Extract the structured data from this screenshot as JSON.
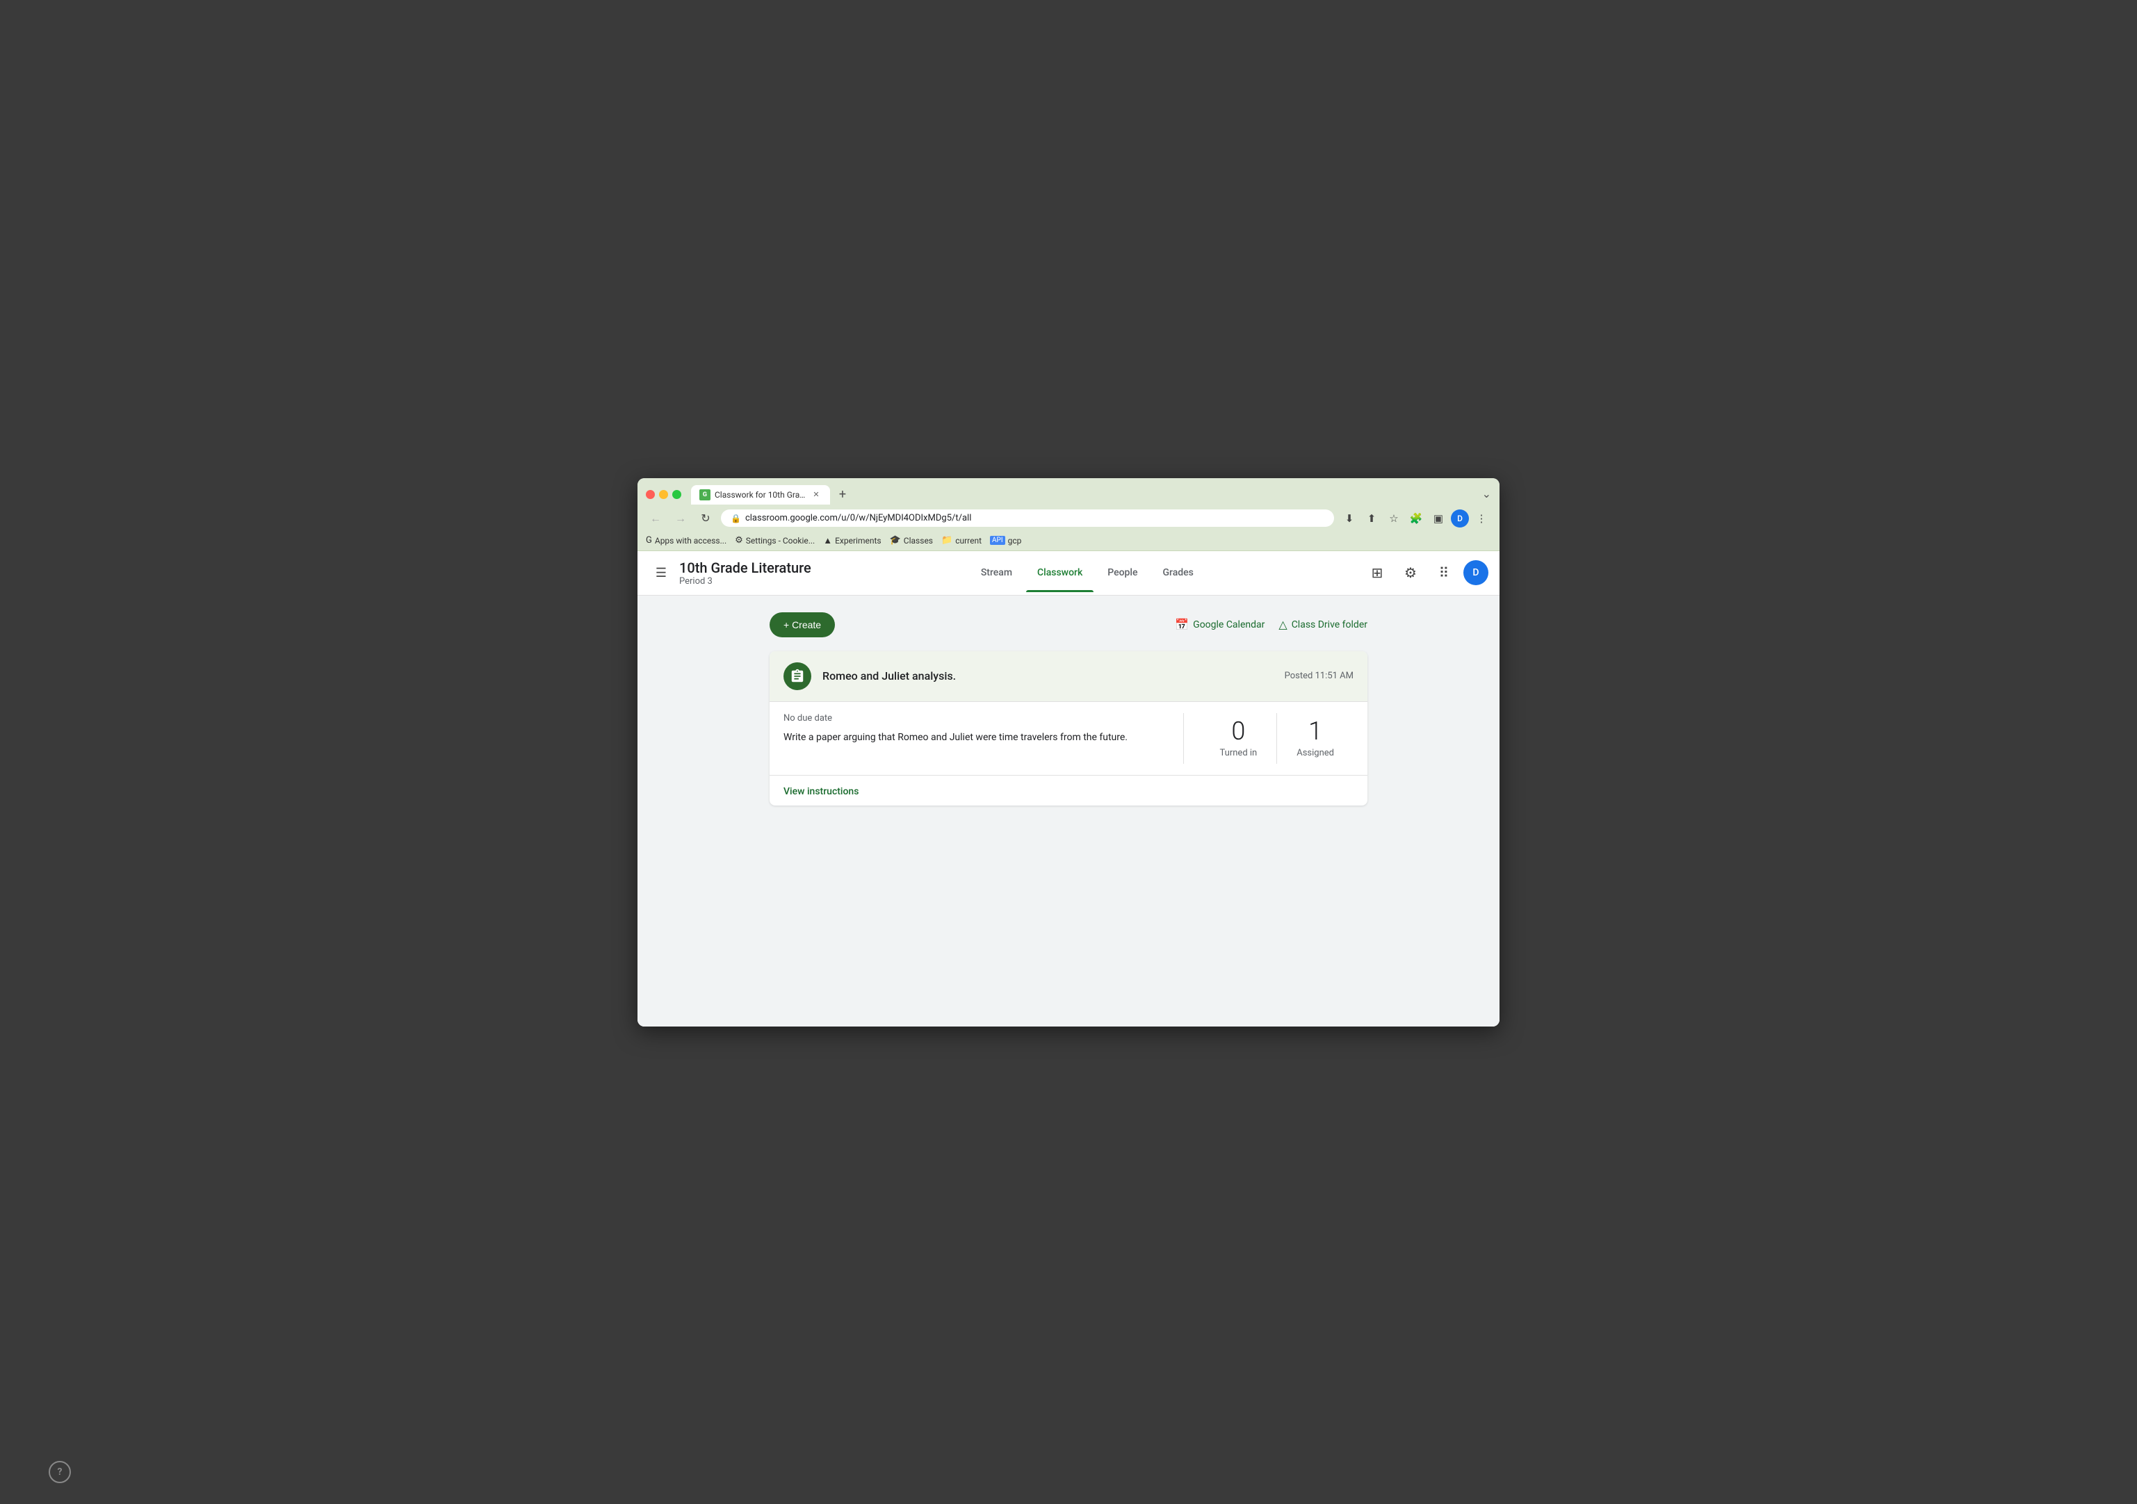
{
  "browser": {
    "tab_title": "Classwork for 10th Grade Liter…",
    "tab_favicon": "G",
    "url": "classroom.google.com/u/0/w/NjEyMDI4ODIxMDg5/t/all",
    "new_tab_label": "+",
    "user_initial": "D",
    "bookmarks": [
      {
        "icon": "G",
        "label": "Apps with access..."
      },
      {
        "icon": "⚙",
        "label": "Settings - Cookie..."
      },
      {
        "icon": "▲",
        "label": "Experiments"
      },
      {
        "icon": "🎓",
        "label": "Classes"
      },
      {
        "icon": "📁",
        "label": "current"
      },
      {
        "icon": "API",
        "label": "gcp"
      }
    ]
  },
  "header": {
    "class_name": "10th Grade Literature",
    "period": "Period 3",
    "hamburger_icon": "☰",
    "nav_items": [
      {
        "label": "Stream",
        "active": false
      },
      {
        "label": "Classwork",
        "active": true
      },
      {
        "label": "People",
        "active": false
      },
      {
        "label": "Grades",
        "active": false
      }
    ],
    "user_initial": "D"
  },
  "toolbar": {
    "create_label": "+ Create",
    "google_calendar_label": "Google Calendar",
    "class_drive_folder_label": "Class Drive folder"
  },
  "assignment": {
    "title": "Romeo and Juliet analysis.",
    "posted": "Posted 11:51 AM",
    "due_label": "No due date",
    "description": "Write a paper arguing that Romeo and Juliet were time travelers from the future.",
    "turned_in_count": "0",
    "turned_in_label": "Turned in",
    "assigned_count": "1",
    "assigned_label": "Assigned",
    "view_instructions_label": "View instructions"
  },
  "help": {
    "label": "?"
  }
}
